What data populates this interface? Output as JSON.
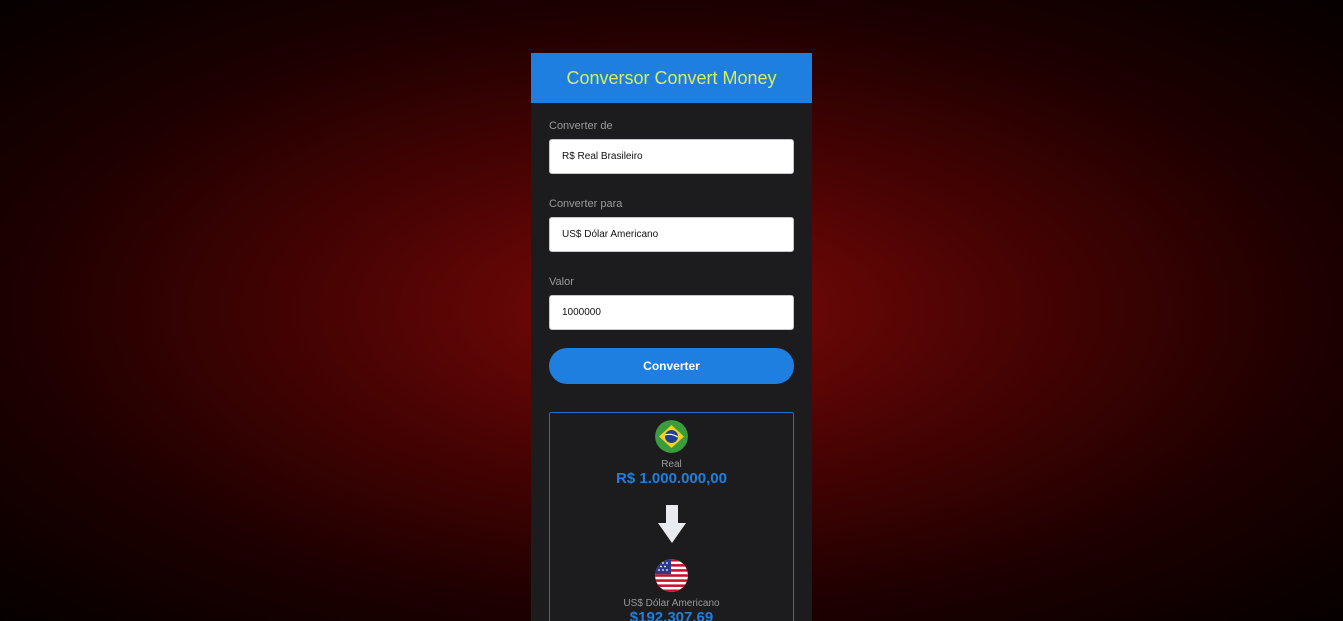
{
  "header": {
    "title": "Conversor Convert Money"
  },
  "form": {
    "from_label": "Converter de",
    "from_value": "R$ Real Brasileiro",
    "to_label": "Converter para",
    "to_value": "US$ Dólar Americano",
    "amount_label": "Valor",
    "amount_value": "1000000",
    "convert_button": "Converter"
  },
  "result": {
    "from_currency_name": "Real",
    "from_amount": "R$ 1.000.000,00",
    "from_flag_icon": "brazil-flag-icon",
    "arrow_icon": "arrow-down-icon",
    "to_currency_name": "US$ Dólar Americano",
    "to_amount": "$192,307.69",
    "to_flag_icon": "usa-flag-icon"
  },
  "colors": {
    "accent": "#1f7fe0",
    "title": "#d4f05a",
    "panel": "#1c1c1e"
  }
}
